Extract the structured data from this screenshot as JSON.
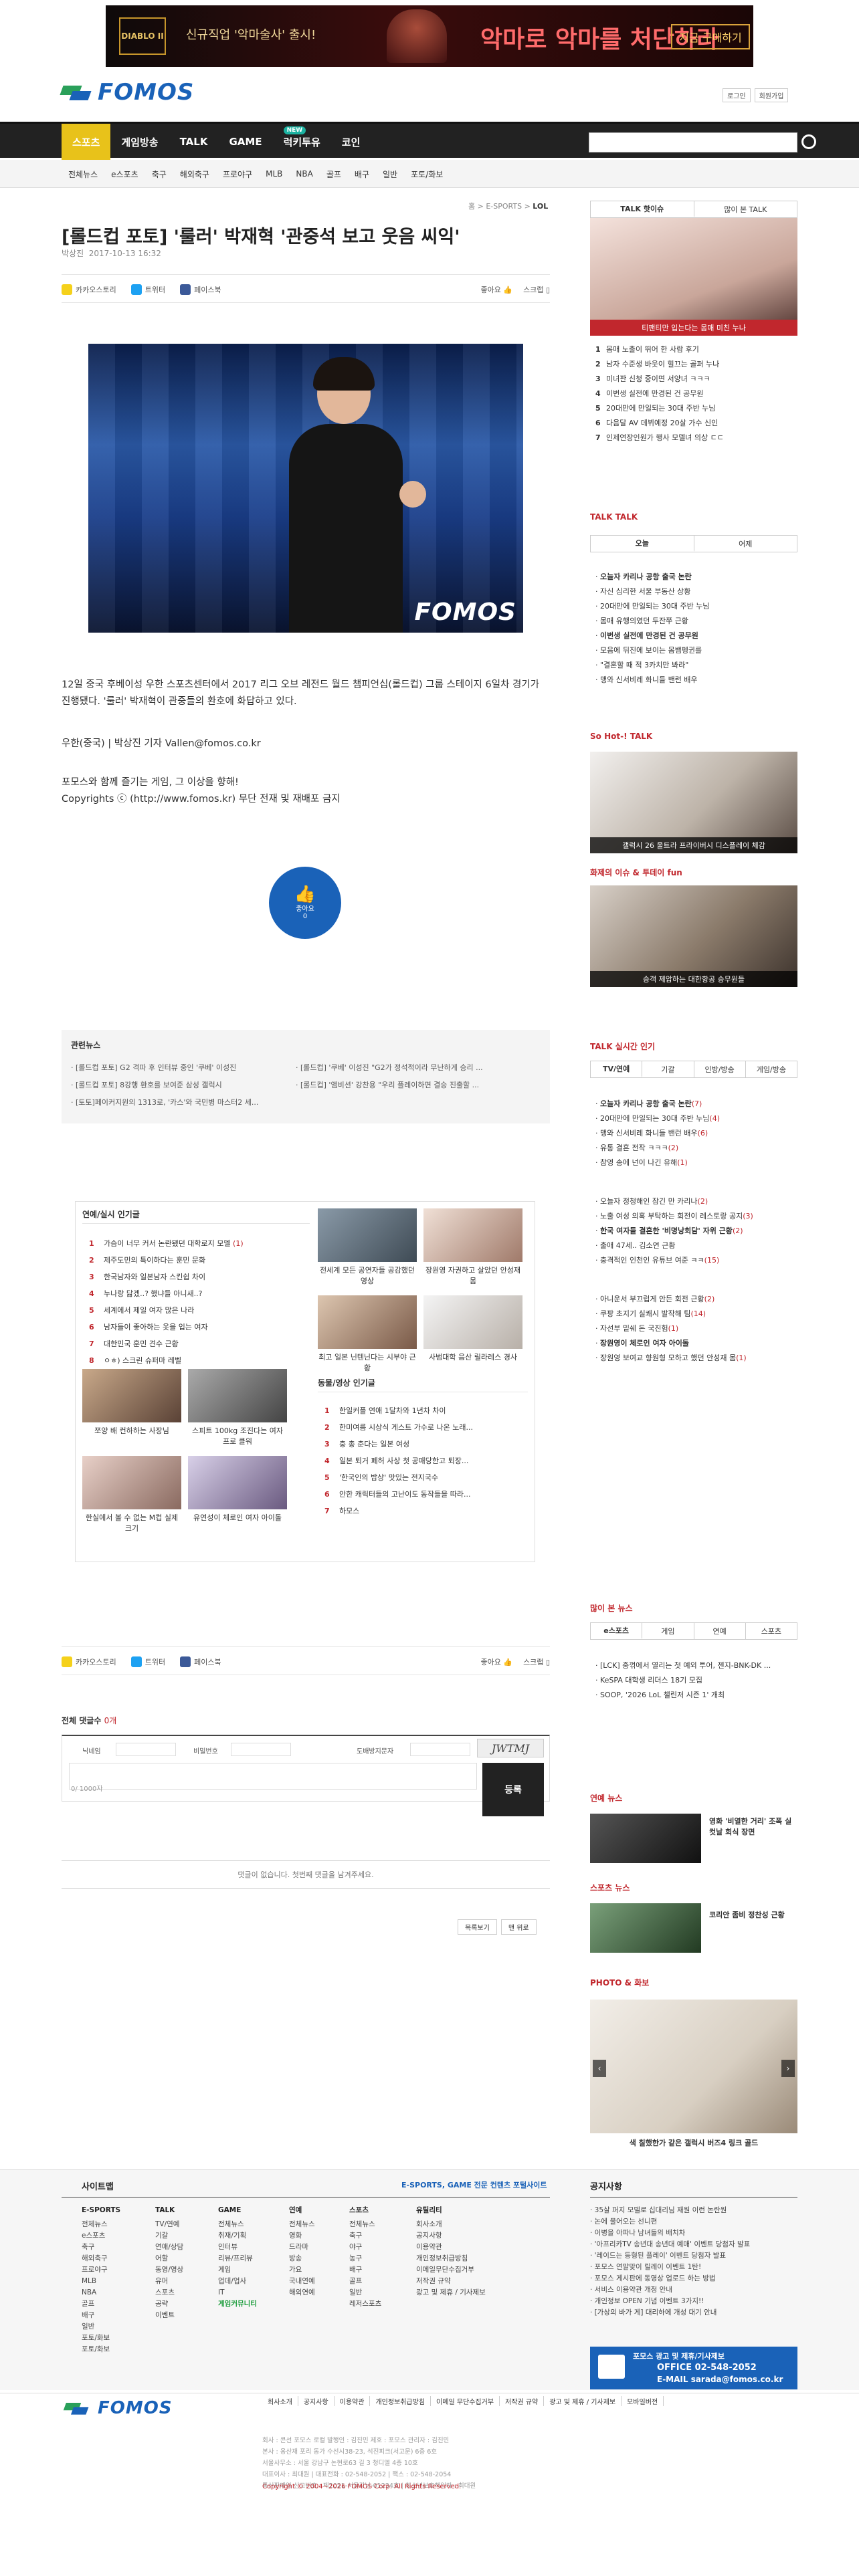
{
  "banner": {
    "logo": "DIABLO II",
    "sub": "신규직업 '악마술사' 출시!",
    "main": "악마로 악마를 처단하라",
    "cta": "지금 구매하기"
  },
  "header": {
    "logo_text": "FOMOS",
    "links": [
      "로그인",
      "회원가입"
    ]
  },
  "gnb": {
    "items": [
      "스포츠",
      "게임방송",
      "TALK",
      "GAME",
      "럭키투유",
      "코인"
    ],
    "new_badge": "NEW"
  },
  "subnav": [
    "전체뉴스",
    "e스포츠",
    "축구",
    "해외축구",
    "프로야구",
    "MLB",
    "NBA",
    "골프",
    "배구",
    "일반",
    "포토/화보"
  ],
  "article": {
    "breadcrumb": "홈 > E-SPORTS > ",
    "breadcrumb_last": "LOL",
    "title": "[롤드컵 포토] '룰러' 박재혁 '관중석 보고 웃음 씨익'",
    "reporter": "박상진",
    "date": "2017-10-13 16:32",
    "photo_watermark": "FOMOS",
    "body": "12일 중국 후베이성 우한 스포츠센터에서 2017 리그 오브 레전드 월드 챔피언십(롤드컵) 그룹 스테이지 6일차 경기가 진행됐다. '룰러' 박재혁이 관중들의 환호에 화답하고 있다.",
    "byline": "우한(중국) | 박상진 기자 Vallen@fomos.co.kr",
    "slogan": "포모스와 함께 즐기는 게임, 그 이상을 향해!",
    "copyright": "Copyrights ⓒ (http://www.fomos.kr) 무단 전재 및 재배포 금지"
  },
  "share": {
    "kakao": "카카오스토리",
    "twitter": "트위터",
    "facebook": "페이스북",
    "like": "좋아요",
    "scrap": "스크랩"
  },
  "like_button": {
    "label": "좋아요",
    "count": "0"
  },
  "related": {
    "title": "관련뉴스",
    "left": [
      "· [롤드컵 포토] G2 격파 후 인터뷰 중인 '쿠베' 이성진",
      "· [롤드컵 포토] 8강행 환호를 보여준 삼성 갤럭시",
      "· [토토]페이커지원의 1313로, '카스'와 국민병 마스터2 세..."
    ],
    "right": [
      "· [롤드컵] '쿠베' 이성진 \"G2가 정석적이라 무난하게 승리 ...",
      "· [롤드컵] '앰비션' 강찬용 \"우리 플레이하면 결승 진출할 ..."
    ]
  },
  "popular": {
    "title": "연예/실시 인기글",
    "list": [
      {
        "n": "1",
        "t": "가슴이 너무 커서 논란됐던 대학로지 모델",
        "c": "(1)"
      },
      {
        "n": "2",
        "t": "제주도민의 특이하다는 훈민 문화",
        "c": ""
      },
      {
        "n": "3",
        "t": "한국남자와 일본남자 스킨쉽 차이",
        "c": ""
      },
      {
        "n": "4",
        "t": "누나랑 닮겠..? 했냐들 아니새..?",
        "c": ""
      },
      {
        "n": "5",
        "t": "세계에서 제일 여자 많은 나라",
        "c": ""
      },
      {
        "n": "6",
        "t": "남자들이 좋아하는 옷을 입는 여자",
        "c": ""
      },
      {
        "n": "7",
        "t": "대한민국 훈민 견수 근황",
        "c": ""
      },
      {
        "n": "8",
        "t": "ㅇㅎ) 스크린 슈퍼마 레벨",
        "c": ""
      }
    ],
    "thumbs_top": [
      "전세계 모든 공연자들 공감했던 영상",
      "장원영 자권하고 살았던 안성재 몸",
      "최고 일본 닌텐닌다는 시부야 근황",
      "사범대학 음산 릴라레스 경사"
    ],
    "thumbs_bottom": [
      "쪼양 배 컨하하는 사장님",
      "스피트 100kg 조진다는 여자 프로 클워",
      "한실에서 볼 수 없는 M컵 실제 크기",
      "유연성이 체로인 여자 아이돌"
    ],
    "video_title": "동물/영상 인기글",
    "video_list": [
      {
        "n": "1",
        "t": "한일커플 연애 1달차와 1년차 차이"
      },
      {
        "n": "2",
        "t": "한미여름 시상식 게스트 가수로 나온 노래..."
      },
      {
        "n": "3",
        "t": "충 총 춘다는 일본 여성"
      },
      {
        "n": "4",
        "t": "일본 퇴거 폐허 사상 첫 공매당한고 퇴장..."
      },
      {
        "n": "5",
        "t": "'한국인의 밥상' 맛있는 전지국수"
      },
      {
        "n": "6",
        "t": "안한 캐릭터들의 고난이도 동작들을 따라..."
      },
      {
        "n": "7",
        "t": "하모스"
      }
    ]
  },
  "comments": {
    "title": "전체 댓글수",
    "count": "0개",
    "name_label": "닉네임",
    "pw_label": "비밀번호",
    "captcha_label": "도배방지문자",
    "captcha": "JWTMJ",
    "submit": "등록",
    "chars": "0/ 1000자",
    "empty": "댓글이 없습니다. 첫번째 댓글을 남겨주세요.",
    "btn_list": "목록보기",
    "btn_top": "맨 위로"
  },
  "sidebar": {
    "talk_tabs": [
      "TALK 핫이슈",
      "많이 본 TALK"
    ],
    "talk_caption": "티팬티만 입는다는 몸매 미친 누나",
    "talk_list": [
      "몸매 노출이 뛰어 한 사람 후기",
      "남자 수준생 바웃이 힐끄는 골퍼 누나",
      "미녀판 신청 중이면 서양녀 ㅋㅋㅋ",
      "이번생 실전에 만경된 건 공무원",
      "20대만에 만일되는 30대 주반 누님",
      "다음달 AV 데뷔예정 20살 가수 신인",
      "인제연장인원가 행사 모델녀 의상 ㄷㄷ"
    ],
    "talk_talk_title": "TALK TALK",
    "talk_talk_tabs": [
      "오늘",
      "어제"
    ],
    "talk_talk_list": [
      "오늘자 카리나 공항 출국 논란",
      "자신 심리한 서울 부동산 상황",
      "20대만에 만일되는 30대 주반 누님",
      "몸매 유행의였던 두잔쭈 근황",
      "이번생 실전에 만경된 건 공무원",
      "모음에 뒤진에 보이는 몸뱀펭귄를",
      "\"결혼할 때 적 3카치만 봐라\"",
      "맹와 신서비레 화니들 밴런 배우"
    ],
    "hot_title": "So Hot-! TALK",
    "hot_caption": "갤럭시 26 울트라 프라이버시 디스플레이 체감",
    "fun_title": "화제의 이슈 & 투데이 fun",
    "fun_caption": "승객 제압하는 대한항공 승무원들",
    "realtime_title": "TALK 실시간 인기",
    "realtime_tabs": [
      "TV/연예",
      "기갈",
      "인방/방송",
      "게임/방송"
    ],
    "realtime_list_a": [
      {
        "t": "오늘자 카리나 공항 출국 논란",
        "c": "(7)"
      },
      {
        "t": "20대만에 만일되는 30대 주반 누님",
        "c": "(4)"
      },
      {
        "t": "맹와 신서비레 화니들 밴런 배우",
        "c": "(6)"
      },
      {
        "t": "유통 결혼 전작 ㅋㅋㅋ",
        "c": "(2)"
      },
      {
        "t": "참영 송에 넌이 나긴 유해",
        "c": "(1)"
      }
    ],
    "realtime_list_b": [
      {
        "t": "오늘자 정청해인 잠긴 만 카리나",
        "c": "(2)"
      },
      {
        "t": "노출 여성 의혹 부탁하는 회전이 레스토랑 공지",
        "c": "(3)"
      },
      {
        "t": "한국 여자들 결혼한 '비명낭회담' 자위 근황",
        "c": "(2)"
      },
      {
        "t": "출애 47세.. 김소연 근황",
        "c": ""
      },
      {
        "t": "충격적인 인천인 유튜브 여준 ㅋㅋ",
        "c": "(15)"
      }
    ],
    "realtime_list_c": [
      {
        "t": "아니운서 부끄럽게 안든 회전 근황",
        "c": "(2)"
      },
      {
        "t": "쿠팡 초지기 실쾌시 발작해 팀",
        "c": "(14)"
      },
      {
        "t": "자선부 밑쉐 돈 국진험",
        "c": "(1)"
      },
      {
        "t": "장원영이 체로인 여자 아이돌",
        "c": ""
      },
      {
        "t": "장원영 보여교 향원형 모하고 했던 안성재 몸",
        "c": "(1)"
      }
    ],
    "most_title": "많이 본 뉴스",
    "most_tabs": [
      "e스포츠",
      "게임",
      "연예",
      "스포츠"
    ],
    "most_list": [
      "[LCK] 중꺾에서 열리는 첫 예외 투어, 젠지-BNK-DK ...",
      "KeSPA 대학생 리더스 18기 모집",
      "SOOP, '2026 LoL 챌린저 시즌 1' 개최"
    ],
    "ent_title": "연예 뉴스",
    "ent_news": "영화 '비열한 거리' 조폭 실컷날 회식 장면",
    "sports_title": "스포츠 뉴스",
    "sports_news": "코리안 좀비 정찬성 근황",
    "photo_title": "PHOTO & 화보",
    "photo_caption": "색 칠했한가 같은 갤럭시 버즈4 링크 골드"
  },
  "footer": {
    "sitemap": "사이트맵",
    "tagline": "E-SPORTS, GAME 전문 컨텐츠 포털사이트",
    "notice": "공지사항",
    "cols": [
      {
        "h": "E-SPORTS",
        "items": [
          "전체뉴스",
          "e스포츠",
          "축구",
          "해외축구",
          "프로야구",
          "MLB",
          "NBA",
          "골프",
          "배구",
          "일반",
          "포토/화보",
          "포토/화보"
        ]
      },
      {
        "h": "TALK",
        "items": [
          "TV/연예",
          "기갈",
          "연애/상담",
          "어할",
          "동영/영상",
          "유머",
          "스포츠",
          "공략",
          "이벤트"
        ]
      },
      {
        "h": "GAME",
        "items": [
          "전체뉴스",
          "취재/기획",
          "인터뷰",
          "리뷰/프리뷰",
          "게임",
          "업데/업사",
          "IT",
          "게임커뮤니티"
        ]
      },
      {
        "h": "연예",
        "items": [
          "전체뉴스",
          "영화",
          "드라마",
          "방송",
          "가요",
          "국내연예",
          "해외연예"
        ]
      },
      {
        "h": "스포츠",
        "items": [
          "전체뉴스",
          "축구",
          "야구",
          "농구",
          "배구",
          "골프",
          "일반",
          "레저스포츠"
        ]
      },
      {
        "h": "유틸리티",
        "items": [
          "회사소개",
          "공지사항",
          "이용약관",
          "개인정보취급방침",
          "이메일무단수집거부",
          "저작권 규약",
          "광고 및 제휴 / 기사제보"
        ]
      }
    ],
    "notices": [
      "35살 퍼지 모델로 십대리님 재원 이런 논란원",
      "논에 물어오는 선니편",
      "이병을 아파나 남녀들의 배치차",
      "'아프리카TV 송년대 송년대 예매' 이벤트 당첨자 발표",
      "'레이드는 등형된 플레이' 이벤트 당첨자 발표",
      "포모스 연말맞이 릴레이 이벤트 1탄!",
      "포모스 게시판에 동영상 업로드 하는 방법",
      "서비스 이용약관 개정 안내",
      "개인정보 OPEN 기념 이벤트 3가지!!",
      "[가상의 바가 게] 대리하에 개성 대기 안내"
    ],
    "ad_box": {
      "title": "포모스 광고 및 제휴/기사제보",
      "office": "OFFICE  02-548-2052",
      "email": "E-MAIL  sarada@fomos.co.kr"
    },
    "menu": [
      "회사소개",
      "공지사항",
      "이용약관",
      "개인정보취급방침",
      "이메일 무단수집거부",
      "저작권 규약",
      "광고 및 제휴 / 기사제보",
      "모바일버전"
    ],
    "info": [
      "회사 : 콘선 포모스 로컬 발행인 : 김진민 제호 : 포모스 관리자 : 김진민",
      "본사 : 옹산재 포리 동가 수선시38-23, 석진피크(서고문) 6층 6호",
      "서울사무소 : 서울 강남구 논현로63 길 3 청디엘 4층 10호",
      "대표이사 : 최대원 | 대표전화 : 02-548-2052 | 팩스 : 02-548-2054",
      "통신판매업 신고번호 : 제2021-서울강남-01234호 | 청소년보호책임자 : 최대원"
    ],
    "copyright": "Copyright © 2004~2026 FOMOS Corp. All Rights Reserved.",
    "top": "^"
  }
}
